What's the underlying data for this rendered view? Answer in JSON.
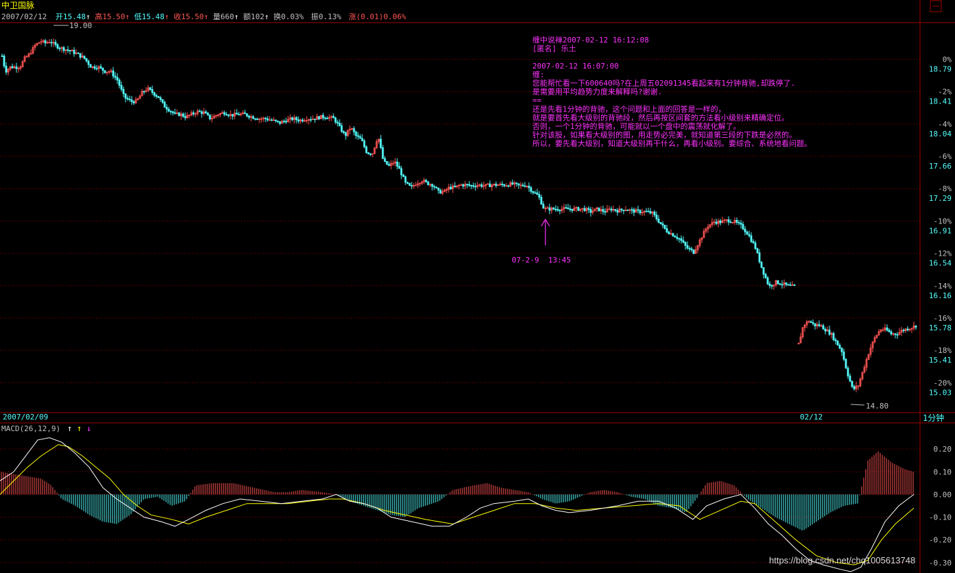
{
  "header": {
    "stock_name": "中卫国脉",
    "date": "2007/02/12",
    "open_label": "开",
    "open": "15.48",
    "high_label": "高",
    "high": "15.50",
    "low_label": "低",
    "low": "15.48",
    "close_label": "收",
    "close": "15.50",
    "volume_label": "量",
    "volume": "660",
    "amount_label": "额",
    "amount": "102",
    "turnover_label": "换",
    "turnover": "0.03%",
    "amplitude_label": "振",
    "amplitude": "0.13%",
    "change_label": "涨",
    "change": "(0.01)0.06%"
  },
  "colors": {
    "up": "#ff5555",
    "down": "#54ffff",
    "grid": "#a00000",
    "annotation": "#ff33ff",
    "dif": "#ffffff",
    "dea": "#ffff00",
    "text": "#c0c0c0"
  },
  "chart_data": [
    {
      "type": "candlestick",
      "name": "price",
      "interval_label": "1分钟",
      "ylim": [
        14.7,
        19.2
      ],
      "y_ticks_price": [
        "18.79",
        "18.41",
        "18.04",
        "17.66",
        "17.29",
        "16.91",
        "16.54",
        "16.16",
        "15.78",
        "15.41",
        "15.03"
      ],
      "y_ticks_pct": [
        "0%",
        "-2%",
        "-4%",
        "-6%",
        "-8%",
        "-10%",
        "-12%",
        "-14%",
        "-16%",
        "-18%",
        "-20%"
      ],
      "x_labels": [
        "2007/02/09",
        "02/12"
      ],
      "max_marker": "19.00",
      "min_marker": "14.80",
      "path": [
        [
          0,
          18.9
        ],
        [
          7,
          18.65
        ],
        [
          14,
          18.7
        ],
        [
          21,
          18.7
        ],
        [
          28,
          18.7
        ],
        [
          35,
          18.8
        ],
        [
          42,
          18.85
        ],
        [
          50,
          18.95
        ],
        [
          58,
          19.0
        ],
        [
          65,
          18.98
        ],
        [
          72,
          19.0
        ],
        [
          80,
          18.95
        ],
        [
          88,
          18.92
        ],
        [
          96,
          18.9
        ],
        [
          104,
          18.88
        ],
        [
          112,
          18.85
        ],
        [
          122,
          18.8
        ],
        [
          132,
          18.7
        ],
        [
          142,
          18.7
        ],
        [
          152,
          18.65
        ],
        [
          160,
          18.65
        ],
        [
          170,
          18.55
        ],
        [
          180,
          18.35
        ],
        [
          190,
          18.3
        ],
        [
          198,
          18.3
        ],
        [
          206,
          18.4
        ],
        [
          214,
          18.45
        ],
        [
          222,
          18.4
        ],
        [
          230,
          18.35
        ],
        [
          238,
          18.25
        ],
        [
          246,
          18.2
        ],
        [
          254,
          18.15
        ],
        [
          262,
          18.15
        ],
        [
          270,
          18.12
        ],
        [
          278,
          18.15
        ],
        [
          286,
          18.18
        ],
        [
          296,
          18.17
        ],
        [
          306,
          18.1
        ],
        [
          316,
          18.15
        ],
        [
          326,
          18.17
        ],
        [
          336,
          18.14
        ],
        [
          346,
          18.15
        ],
        [
          356,
          18.15
        ],
        [
          366,
          18.12
        ],
        [
          376,
          18.1
        ],
        [
          386,
          18.1
        ],
        [
          396,
          18.08
        ],
        [
          406,
          18.05
        ],
        [
          416,
          18.08
        ],
        [
          426,
          18.1
        ],
        [
          436,
          18.08
        ],
        [
          446,
          18.1
        ],
        [
          456,
          18.1
        ],
        [
          466,
          18.12
        ],
        [
          476,
          18.12
        ],
        [
          486,
          18.1
        ],
        [
          494,
          18.0
        ],
        [
          502,
          17.9
        ],
        [
          510,
          18.0
        ],
        [
          518,
          17.9
        ],
        [
          526,
          17.85
        ],
        [
          534,
          17.7
        ],
        [
          542,
          17.7
        ],
        [
          550,
          17.9
        ],
        [
          558,
          17.6
        ],
        [
          566,
          17.55
        ],
        [
          574,
          17.6
        ],
        [
          582,
          17.5
        ],
        [
          590,
          17.35
        ],
        [
          598,
          17.3
        ],
        [
          606,
          17.35
        ],
        [
          614,
          17.38
        ],
        [
          622,
          17.35
        ],
        [
          630,
          17.33
        ],
        [
          638,
          17.25
        ],
        [
          646,
          17.25
        ],
        [
          654,
          17.3
        ],
        [
          662,
          17.3
        ],
        [
          670,
          17.33
        ],
        [
          678,
          17.33
        ],
        [
          686,
          17.32
        ],
        [
          696,
          17.33
        ],
        [
          706,
          17.32
        ],
        [
          716,
          17.33
        ],
        [
          726,
          17.33
        ],
        [
          736,
          17.33
        ],
        [
          746,
          17.34
        ],
        [
          756,
          17.32
        ],
        [
          766,
          17.33
        ],
        [
          776,
          17.25
        ],
        [
          784,
          17.2
        ],
        [
          792,
          17.05
        ],
        [
          800,
          17.05
        ],
        [
          810,
          17.05
        ],
        [
          820,
          17.05
        ],
        [
          830,
          17.05
        ],
        [
          840,
          17.05
        ],
        [
          850,
          17.05
        ],
        [
          860,
          17.02
        ],
        [
          870,
          17.05
        ],
        [
          880,
          17.02
        ],
        [
          890,
          17.05
        ],
        [
          900,
          17.03
        ],
        [
          910,
          17.05
        ],
        [
          920,
          17.03
        ],
        [
          930,
          17.02
        ],
        [
          940,
          17.02
        ],
        [
          950,
          17.0
        ],
        [
          960,
          16.9
        ],
        [
          970,
          16.8
        ],
        [
          980,
          16.75
        ],
        [
          990,
          16.7
        ],
        [
          1000,
          16.6
        ],
        [
          1010,
          16.55
        ],
        [
          1020,
          16.7
        ],
        [
          1030,
          16.85
        ],
        [
          1040,
          16.9
        ],
        [
          1050,
          16.9
        ],
        [
          1060,
          16.92
        ],
        [
          1070,
          16.9
        ],
        [
          1080,
          16.85
        ],
        [
          1090,
          16.75
        ],
        [
          1100,
          16.6
        ],
        [
          1110,
          16.35
        ],
        [
          1120,
          16.15
        ],
        [
          1130,
          16.2
        ],
        [
          1140,
          16.18
        ],
        [
          1150,
          16.15
        ],
        [
          1158,
          16.15
        ],
        [
          1162,
          15.45
        ],
        [
          1170,
          15.7
        ],
        [
          1178,
          15.75
        ],
        [
          1186,
          15.7
        ],
        [
          1194,
          15.7
        ],
        [
          1202,
          15.65
        ],
        [
          1210,
          15.6
        ],
        [
          1218,
          15.5
        ],
        [
          1226,
          15.4
        ],
        [
          1234,
          15.15
        ],
        [
          1242,
          14.95
        ],
        [
          1250,
          15.0
        ],
        [
          1258,
          15.2
        ],
        [
          1266,
          15.4
        ],
        [
          1274,
          15.55
        ],
        [
          1282,
          15.65
        ],
        [
          1290,
          15.65
        ],
        [
          1298,
          15.6
        ],
        [
          1306,
          15.6
        ],
        [
          1314,
          15.64
        ],
        [
          1322,
          15.66
        ],
        [
          1330,
          15.68
        ],
        [
          1335,
          15.7
        ]
      ]
    },
    {
      "type": "macd",
      "name": "MACD",
      "params_label": "MACD(26,12,9)",
      "ylim": [
        -0.34,
        0.27
      ],
      "y_ticks": [
        "0.20",
        "0.10",
        "0.00",
        "-0.10",
        "-0.20",
        "-0.30"
      ],
      "dif": [
        [
          0,
          0.06
        ],
        [
          20,
          0.1
        ],
        [
          40,
          0.18
        ],
        [
          55,
          0.24
        ],
        [
          72,
          0.25
        ],
        [
          90,
          0.23
        ],
        [
          110,
          0.18
        ],
        [
          130,
          0.12
        ],
        [
          150,
          0.03
        ],
        [
          170,
          -0.02
        ],
        [
          190,
          -0.06
        ],
        [
          210,
          -0.1
        ],
        [
          235,
          -0.12
        ],
        [
          255,
          -0.14
        ],
        [
          275,
          -0.11
        ],
        [
          300,
          -0.07
        ],
        [
          325,
          -0.04
        ],
        [
          350,
          -0.02
        ],
        [
          380,
          -0.03
        ],
        [
          410,
          -0.04
        ],
        [
          440,
          -0.03
        ],
        [
          470,
          -0.02
        ],
        [
          490,
          0.0
        ],
        [
          510,
          -0.03
        ],
        [
          530,
          -0.04
        ],
        [
          550,
          -0.06
        ],
        [
          570,
          -0.1
        ],
        [
          600,
          -0.12
        ],
        [
          630,
          -0.14
        ],
        [
          655,
          -0.14
        ],
        [
          680,
          -0.1
        ],
        [
          700,
          -0.06
        ],
        [
          720,
          -0.04
        ],
        [
          750,
          -0.03
        ],
        [
          770,
          -0.02
        ],
        [
          790,
          -0.05
        ],
        [
          810,
          -0.07
        ],
        [
          830,
          -0.08
        ],
        [
          860,
          -0.07
        ],
        [
          900,
          -0.05
        ],
        [
          930,
          -0.03
        ],
        [
          960,
          -0.03
        ],
        [
          985,
          -0.06
        ],
        [
          1010,
          -0.11
        ],
        [
          1030,
          -0.05
        ],
        [
          1055,
          -0.02
        ],
        [
          1080,
          0.0
        ],
        [
          1100,
          -0.06
        ],
        [
          1120,
          -0.13
        ],
        [
          1140,
          -0.18
        ],
        [
          1160,
          -0.24
        ],
        [
          1180,
          -0.29
        ],
        [
          1200,
          -0.31
        ],
        [
          1225,
          -0.33
        ],
        [
          1240,
          -0.34
        ],
        [
          1255,
          -0.32
        ],
        [
          1270,
          -0.24
        ],
        [
          1290,
          -0.12
        ],
        [
          1310,
          -0.05
        ],
        [
          1332,
          0.0
        ]
      ],
      "dea": [
        [
          0,
          0.0
        ],
        [
          20,
          0.06
        ],
        [
          40,
          0.12
        ],
        [
          60,
          0.17
        ],
        [
          85,
          0.22
        ],
        [
          100,
          0.21
        ],
        [
          120,
          0.17
        ],
        [
          140,
          0.12
        ],
        [
          160,
          0.07
        ],
        [
          180,
          0.0
        ],
        [
          200,
          -0.05
        ],
        [
          220,
          -0.09
        ],
        [
          250,
          -0.11
        ],
        [
          275,
          -0.13
        ],
        [
          300,
          -0.1
        ],
        [
          330,
          -0.07
        ],
        [
          360,
          -0.04
        ],
        [
          390,
          -0.04
        ],
        [
          420,
          -0.04
        ],
        [
          450,
          -0.03
        ],
        [
          480,
          -0.02
        ],
        [
          500,
          -0.02
        ],
        [
          530,
          -0.04
        ],
        [
          560,
          -0.07
        ],
        [
          590,
          -0.09
        ],
        [
          620,
          -0.11
        ],
        [
          660,
          -0.13
        ],
        [
          690,
          -0.1
        ],
        [
          720,
          -0.07
        ],
        [
          750,
          -0.04
        ],
        [
          780,
          -0.04
        ],
        [
          810,
          -0.06
        ],
        [
          840,
          -0.07
        ],
        [
          880,
          -0.06
        ],
        [
          920,
          -0.05
        ],
        [
          960,
          -0.04
        ],
        [
          990,
          -0.05
        ],
        [
          1020,
          -0.11
        ],
        [
          1050,
          -0.07
        ],
        [
          1080,
          -0.03
        ],
        [
          1100,
          -0.04
        ],
        [
          1130,
          -0.12
        ],
        [
          1160,
          -0.2
        ],
        [
          1190,
          -0.27
        ],
        [
          1220,
          -0.3
        ],
        [
          1245,
          -0.31
        ],
        [
          1265,
          -0.29
        ],
        [
          1285,
          -0.2
        ],
        [
          1305,
          -0.13
        ],
        [
          1332,
          -0.06
        ]
      ],
      "hist": [
        [
          0,
          0.1
        ],
        [
          20,
          0.09
        ],
        [
          40,
          0.08
        ],
        [
          60,
          0.07
        ],
        [
          75,
          0.04
        ],
        [
          90,
          -0.02
        ],
        [
          110,
          -0.05
        ],
        [
          130,
          -0.09
        ],
        [
          150,
          -0.12
        ],
        [
          170,
          -0.13
        ],
        [
          190,
          -0.09
        ],
        [
          210,
          -0.02
        ],
        [
          230,
          -0.01
        ],
        [
          250,
          -0.05
        ],
        [
          270,
          -0.03
        ],
        [
          285,
          0.04
        ],
        [
          310,
          0.05
        ],
        [
          340,
          0.05
        ],
        [
          370,
          0.03
        ],
        [
          400,
          0.01
        ],
        [
          420,
          0.01
        ],
        [
          440,
          0.02
        ],
        [
          470,
          0.01
        ],
        [
          490,
          0.0
        ],
        [
          510,
          -0.03
        ],
        [
          530,
          -0.05
        ],
        [
          550,
          -0.07
        ],
        [
          570,
          -0.09
        ],
        [
          590,
          -0.1
        ],
        [
          610,
          -0.06
        ],
        [
          640,
          -0.03
        ],
        [
          660,
          0.02
        ],
        [
          690,
          0.04
        ],
        [
          710,
          0.05
        ],
        [
          730,
          0.03
        ],
        [
          750,
          0.02
        ],
        [
          770,
          0.01
        ],
        [
          790,
          -0.02
        ],
        [
          810,
          -0.04
        ],
        [
          830,
          -0.03
        ],
        [
          860,
          0.01
        ],
        [
          880,
          0.02
        ],
        [
          900,
          0.01
        ],
        [
          920,
          -0.01
        ],
        [
          940,
          -0.02
        ],
        [
          960,
          -0.05
        ],
        [
          980,
          -0.06
        ],
        [
          1000,
          -0.08
        ],
        [
          1015,
          -0.02
        ],
        [
          1030,
          0.05
        ],
        [
          1050,
          0.06
        ],
        [
          1070,
          0.04
        ],
        [
          1090,
          -0.02
        ],
        [
          1110,
          -0.06
        ],
        [
          1130,
          -0.1
        ],
        [
          1150,
          -0.13
        ],
        [
          1170,
          -0.16
        ],
        [
          1190,
          -0.12
        ],
        [
          1210,
          -0.08
        ],
        [
          1230,
          -0.05
        ],
        [
          1250,
          -0.04
        ],
        [
          1265,
          0.15
        ],
        [
          1280,
          0.19
        ],
        [
          1300,
          0.14
        ],
        [
          1320,
          0.11
        ],
        [
          1332,
          0.1
        ]
      ]
    }
  ],
  "annotation": {
    "lines": [
      "缠中说禅2007-02-12 16:12:08",
      "[匿名] 乐土",
      "",
      "2007-02-12 16:07:00",
      "缠:",
      "您能帮忙看一下600640吗?在上周五02091345看起来有1分钟背驰,却跌停了.",
      "是需要用平均趋势力度来解释吗?谢谢.",
      " ==",
      "还是先看1分钟的背驰，这个问题和上面的回答是一样的，",
      "就是要首先看大级别的背驰段，然后再按区间套的方法看小级别来精确定位。",
      "否则，一个1分钟的背驰，可能就以一个盘中的震荡就化解了。",
      "针对该股，如果看大级别的图，用走势必完美，就知道第三段的下跌是必然的。",
      "所以，要先看大级别，知道大级别再干什么，再看小级别。要综合、系统地看问题。"
    ],
    "arrow_label": "07-2-9  13:45"
  },
  "watermark": "https://blog.csdn.net/chq1005613748"
}
